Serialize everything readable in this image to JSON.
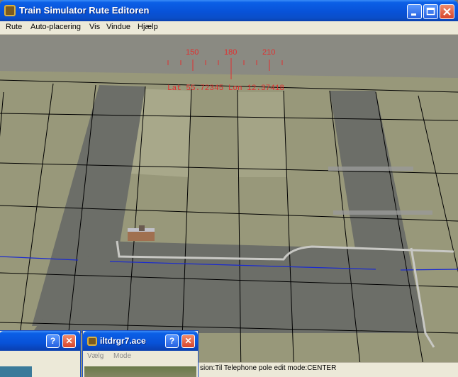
{
  "window": {
    "title": "Train Simulator Rute Editoren"
  },
  "menu": {
    "items": [
      "Rute",
      "Auto-placering",
      "Vis",
      "Vindue",
      "Hjælp"
    ]
  },
  "compass": {
    "ticks": [
      "150",
      "180",
      "210"
    ],
    "position": "Lat 55.72345 Lon 12.37418"
  },
  "statusbar": {
    "text": "sion:Til Telephone pole edit mode:CENTER"
  },
  "left_panel": {
    "help_label": "?",
    "close_label": "✕"
  },
  "texture_panel": {
    "title": "iltdrgr7.ace",
    "help_label": "?",
    "close_label": "✕",
    "menu": [
      "Vælg",
      "Mode"
    ]
  },
  "colors": {
    "titlebar": "#0852d8",
    "grid_line": "#000000",
    "compass": "#e03030",
    "route_line": "#1a2ad0",
    "ground": "#98987a",
    "road": "#6c6e68"
  },
  "icons": [
    "app-icon",
    "minimize-icon",
    "maximize-icon",
    "close-icon",
    "help-icon",
    "texture-icon"
  ]
}
